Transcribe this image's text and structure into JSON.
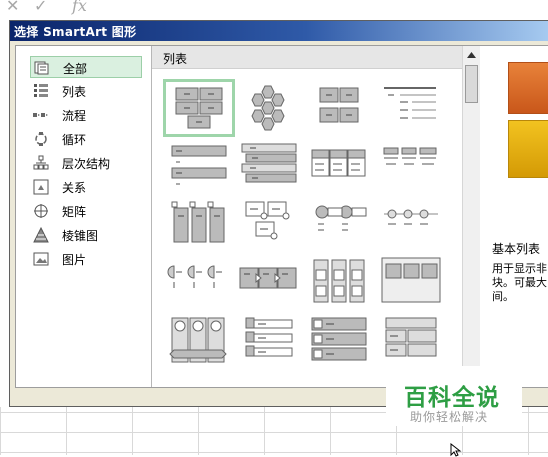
{
  "formula_bar": {
    "fx_label": "fx",
    "cancel_symbol": "✕",
    "enter_symbol": "✓"
  },
  "dialog": {
    "title": "选择 SmartArt 图形",
    "categories": [
      {
        "label": "全部",
        "icon": "all-icon",
        "selected": true
      },
      {
        "label": "列表",
        "icon": "list-icon",
        "selected": false
      },
      {
        "label": "流程",
        "icon": "process-icon",
        "selected": false
      },
      {
        "label": "循环",
        "icon": "cycle-icon",
        "selected": false
      },
      {
        "label": "层次结构",
        "icon": "hierarchy-icon",
        "selected": false
      },
      {
        "label": "关系",
        "icon": "relationship-icon",
        "selected": false
      },
      {
        "label": "矩阵",
        "icon": "matrix-icon",
        "selected": false
      },
      {
        "label": "棱锥图",
        "icon": "pyramid-icon",
        "selected": false
      },
      {
        "label": "图片",
        "icon": "picture-icon",
        "selected": false
      }
    ],
    "gallery_header": "列表",
    "layout_icons": [
      "basic-block-list",
      "hexagon-cluster",
      "stacked-blocks",
      "lined-list",
      "vertical-bullet-list",
      "trapezoid-list",
      "horizontal-bullet-list",
      "tab-list",
      "vertical-box-list",
      "picture-caption-list",
      "circle-bullet-list",
      "horizontal-dot-list",
      "half-circle-list",
      "arrow-process-list",
      "column-list",
      "square-accent-list",
      "picture-strips",
      "tab-vertical-list",
      "grouped-list",
      "table-list"
    ],
    "selected_layout": 0,
    "preview": {
      "swatch_text": "—",
      "title": "基本列表",
      "description": "用于显示非\n块。可最大\n间。"
    }
  },
  "watermark": {
    "title": "百科全说",
    "subtitle": "助你轻松解决"
  },
  "colors": {
    "accent_green": "#2e9e44",
    "selection_green": "#9ed5aa",
    "title_bar": "#0a246a",
    "orange": "#e8823a",
    "gold": "#f2c320"
  }
}
